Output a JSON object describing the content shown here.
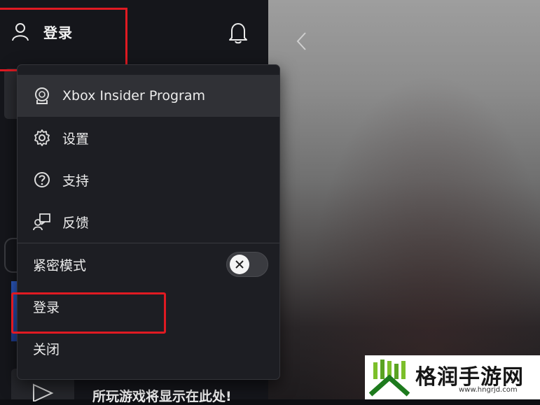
{
  "header": {
    "signin_label": "登录",
    "user_icon": "user-icon",
    "bell_icon": "bell-icon"
  },
  "hero": {
    "prev_icon": "chevron-left-icon"
  },
  "menu": {
    "items": [
      {
        "label": "Xbox Insider Program",
        "icon": "xbox-insider-icon"
      },
      {
        "label": "设置",
        "icon": "gear-icon"
      },
      {
        "label": "支持",
        "icon": "question-icon"
      },
      {
        "label": "反馈",
        "icon": "feedback-icon"
      }
    ],
    "compact_mode": {
      "label": "紧密模式",
      "state": "off"
    },
    "signin_label": "登录",
    "close_label": "关闭"
  },
  "recent": {
    "text": "所玩游戏将显示在此处!"
  },
  "watermark": {
    "title": "格润手游网",
    "url": "www.hngrjd.com"
  },
  "colors": {
    "highlight": "#e01a22",
    "menu_bg": "#1d1e23",
    "sidebar_bg": "#15161b"
  }
}
